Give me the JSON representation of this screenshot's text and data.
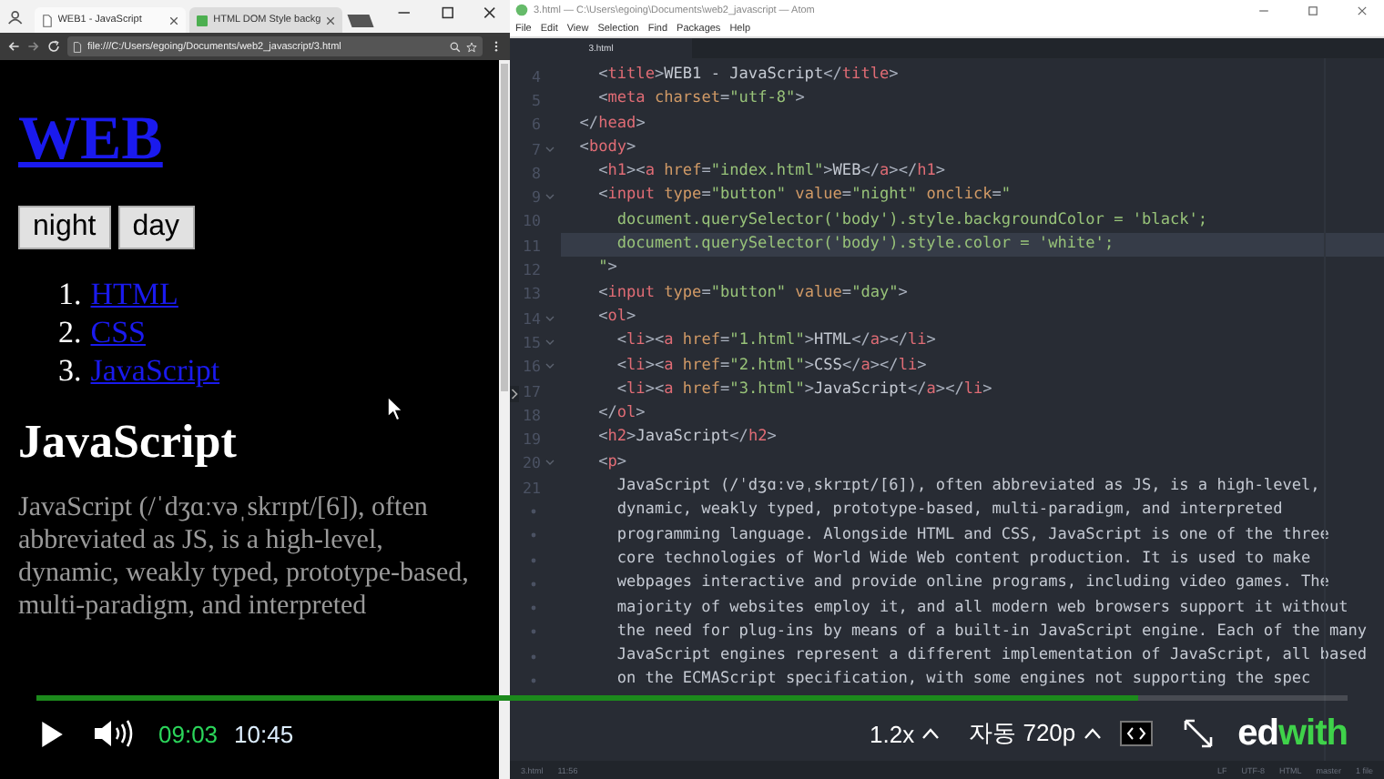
{
  "browser": {
    "tabs": [
      {
        "title": "WEB1 - JavaScript",
        "selected": true
      },
      {
        "title": "HTML DOM Style backg",
        "selected": false
      }
    ],
    "url": "file:///C:/Users/egoing/Documents/web2_javascript/3.html",
    "page": {
      "heading": "WEB",
      "buttons": [
        "night",
        "day"
      ],
      "list": [
        {
          "number": "1.",
          "label": "HTML"
        },
        {
          "number": "2.",
          "label": "CSS"
        },
        {
          "number": "3.",
          "label": "JavaScript"
        }
      ],
      "subheading": "JavaScript",
      "paragraph": "JavaScript (/ˈdʒɑːvəˌskrɪpt/[6]), often abbreviated as JS, is a high-level, dynamic, weakly typed, prototype-based, multi-paradigm, and interpreted"
    }
  },
  "editor": {
    "title": "3.html — C:\\Users\\egoing\\Documents\\web2_javascript — Atom",
    "menu": [
      "File",
      "Edit",
      "View",
      "Selection",
      "Find",
      "Packages",
      "Help"
    ],
    "tabs": [
      {
        "title": "3.html",
        "selected": true
      }
    ],
    "lines": [
      {
        "kind": "line",
        "number": "4",
        "fold": false,
        "current": false,
        "tokens": [
          {
            "kind": "punct",
            "text": "    <"
          },
          {
            "kind": "tag",
            "text": "title"
          },
          {
            "kind": "punct",
            "text": ">"
          },
          {
            "kind": "text",
            "text": "WEB1 - JavaScript"
          },
          {
            "kind": "punct",
            "text": "</"
          },
          {
            "kind": "tag",
            "text": "title"
          },
          {
            "kind": "punct",
            "text": ">"
          }
        ]
      },
      {
        "kind": "line",
        "number": "5",
        "fold": false,
        "current": false,
        "tokens": [
          {
            "kind": "punct",
            "text": "    <"
          },
          {
            "kind": "tag",
            "text": "meta"
          },
          {
            "kind": "attr",
            "text": " charset"
          },
          {
            "kind": "punct",
            "text": "="
          },
          {
            "kind": "string",
            "text": "\"utf-8\""
          },
          {
            "kind": "punct",
            "text": ">"
          }
        ]
      },
      {
        "kind": "line",
        "number": "6",
        "fold": false,
        "current": false,
        "tokens": [
          {
            "kind": "punct",
            "text": "  </"
          },
          {
            "kind": "tag",
            "text": "head"
          },
          {
            "kind": "punct",
            "text": ">"
          }
        ]
      },
      {
        "kind": "line",
        "number": "7",
        "fold": true,
        "current": false,
        "tokens": [
          {
            "kind": "punct",
            "text": "  <"
          },
          {
            "kind": "tag",
            "text": "body"
          },
          {
            "kind": "punct",
            "text": ">"
          }
        ]
      },
      {
        "kind": "line",
        "number": "8",
        "fold": false,
        "current": false,
        "tokens": [
          {
            "kind": "punct",
            "text": "    <"
          },
          {
            "kind": "tag",
            "text": "h1"
          },
          {
            "kind": "punct",
            "text": "><"
          },
          {
            "kind": "tag",
            "text": "a"
          },
          {
            "kind": "attr",
            "text": " href"
          },
          {
            "kind": "punct",
            "text": "="
          },
          {
            "kind": "string",
            "text": "\"index.html\""
          },
          {
            "kind": "punct",
            "text": ">"
          },
          {
            "kind": "text",
            "text": "WEB"
          },
          {
            "kind": "punct",
            "text": "</"
          },
          {
            "kind": "tag",
            "text": "a"
          },
          {
            "kind": "punct",
            "text": "></"
          },
          {
            "kind": "tag",
            "text": "h1"
          },
          {
            "kind": "punct",
            "text": ">"
          }
        ]
      },
      {
        "kind": "line",
        "number": "9",
        "fold": true,
        "current": false,
        "tokens": [
          {
            "kind": "punct",
            "text": "    <"
          },
          {
            "kind": "tag",
            "text": "input"
          },
          {
            "kind": "attr",
            "text": " type"
          },
          {
            "kind": "punct",
            "text": "="
          },
          {
            "kind": "string",
            "text": "\"button\""
          },
          {
            "kind": "attr",
            "text": " value"
          },
          {
            "kind": "punct",
            "text": "="
          },
          {
            "kind": "string",
            "text": "\"night\""
          },
          {
            "kind": "attr",
            "text": " onclick"
          },
          {
            "kind": "punct",
            "text": "="
          },
          {
            "kind": "string",
            "text": "\""
          }
        ]
      },
      {
        "kind": "line",
        "number": "10",
        "fold": false,
        "current": false,
        "tokens": [
          {
            "kind": "string",
            "text": "      document.querySelector('body').style.backgroundColor = 'black';"
          }
        ]
      },
      {
        "kind": "line",
        "number": "11",
        "fold": false,
        "current": true,
        "tokens": [
          {
            "kind": "string",
            "text": "      document.querySelector('body').style.color = 'white';"
          }
        ]
      },
      {
        "kind": "line",
        "number": "12",
        "fold": false,
        "current": false,
        "tokens": [
          {
            "kind": "string",
            "text": "    \""
          },
          {
            "kind": "punct",
            "text": ">"
          }
        ]
      },
      {
        "kind": "line",
        "number": "13",
        "fold": false,
        "current": false,
        "tokens": [
          {
            "kind": "punct",
            "text": "    <"
          },
          {
            "kind": "tag",
            "text": "input"
          },
          {
            "kind": "attr",
            "text": " type"
          },
          {
            "kind": "punct",
            "text": "="
          },
          {
            "kind": "string",
            "text": "\"button\""
          },
          {
            "kind": "attr",
            "text": " value"
          },
          {
            "kind": "punct",
            "text": "="
          },
          {
            "kind": "string",
            "text": "\"day\""
          },
          {
            "kind": "punct",
            "text": ">"
          }
        ]
      },
      {
        "kind": "line",
        "number": "14",
        "fold": true,
        "current": false,
        "tokens": [
          {
            "kind": "punct",
            "text": "    <"
          },
          {
            "kind": "tag",
            "text": "ol"
          },
          {
            "kind": "punct",
            "text": ">"
          }
        ]
      },
      {
        "kind": "line",
        "number": "15",
        "fold": true,
        "current": false,
        "tokens": [
          {
            "kind": "punct",
            "text": "      <"
          },
          {
            "kind": "tag",
            "text": "li"
          },
          {
            "kind": "punct",
            "text": "><"
          },
          {
            "kind": "tag",
            "text": "a"
          },
          {
            "kind": "attr",
            "text": " href"
          },
          {
            "kind": "punct",
            "text": "="
          },
          {
            "kind": "string",
            "text": "\"1.html\""
          },
          {
            "kind": "punct",
            "text": ">"
          },
          {
            "kind": "text",
            "text": "HTML"
          },
          {
            "kind": "punct",
            "text": "</"
          },
          {
            "kind": "tag",
            "text": "a"
          },
          {
            "kind": "punct",
            "text": "></"
          },
          {
            "kind": "tag",
            "text": "li"
          },
          {
            "kind": "punct",
            "text": ">"
          }
        ]
      },
      {
        "kind": "line",
        "number": "16",
        "fold": true,
        "current": false,
        "tokens": [
          {
            "kind": "punct",
            "text": "      <"
          },
          {
            "kind": "tag",
            "text": "li"
          },
          {
            "kind": "punct",
            "text": "><"
          },
          {
            "kind": "tag",
            "text": "a"
          },
          {
            "kind": "attr",
            "text": " href"
          },
          {
            "kind": "punct",
            "text": "="
          },
          {
            "kind": "string",
            "text": "\"2.html\""
          },
          {
            "kind": "punct",
            "text": ">"
          },
          {
            "kind": "text",
            "text": "CSS"
          },
          {
            "kind": "punct",
            "text": "</"
          },
          {
            "kind": "tag",
            "text": "a"
          },
          {
            "kind": "punct",
            "text": "></"
          },
          {
            "kind": "tag",
            "text": "li"
          },
          {
            "kind": "punct",
            "text": ">"
          }
        ]
      },
      {
        "kind": "line",
        "number": "17",
        "fold": false,
        "current": false,
        "tokens": [
          {
            "kind": "punct",
            "text": "      <"
          },
          {
            "kind": "tag",
            "text": "li"
          },
          {
            "kind": "punct",
            "text": "><"
          },
          {
            "kind": "tag",
            "text": "a"
          },
          {
            "kind": "attr",
            "text": " href"
          },
          {
            "kind": "punct",
            "text": "="
          },
          {
            "kind": "string",
            "text": "\"3.html\""
          },
          {
            "kind": "punct",
            "text": ">"
          },
          {
            "kind": "text",
            "text": "JavaScript"
          },
          {
            "kind": "punct",
            "text": "</"
          },
          {
            "kind": "tag",
            "text": "a"
          },
          {
            "kind": "punct",
            "text": "></"
          },
          {
            "kind": "tag",
            "text": "li"
          },
          {
            "kind": "punct",
            "text": ">"
          }
        ]
      },
      {
        "kind": "line",
        "number": "18",
        "fold": false,
        "current": false,
        "tokens": [
          {
            "kind": "punct",
            "text": "    </"
          },
          {
            "kind": "tag",
            "text": "ol"
          },
          {
            "kind": "punct",
            "text": ">"
          }
        ]
      },
      {
        "kind": "line",
        "number": "19",
        "fold": false,
        "current": false,
        "tokens": [
          {
            "kind": "punct",
            "text": "    <"
          },
          {
            "kind": "tag",
            "text": "h2"
          },
          {
            "kind": "punct",
            "text": ">"
          },
          {
            "kind": "text",
            "text": "JavaScript"
          },
          {
            "kind": "punct",
            "text": "</"
          },
          {
            "kind": "tag",
            "text": "h2"
          },
          {
            "kind": "punct",
            "text": ">"
          }
        ]
      },
      {
        "kind": "line",
        "number": "20",
        "fold": true,
        "current": false,
        "tokens": [
          {
            "kind": "punct",
            "text": "    <"
          },
          {
            "kind": "tag",
            "text": "p"
          },
          {
            "kind": "punct",
            "text": ">"
          }
        ]
      },
      {
        "kind": "line",
        "number": "21",
        "fold": false,
        "current": false,
        "tokens": [
          {
            "kind": "text",
            "text": "      JavaScript (/ˈdʒɑːvəˌskrɪpt/[6]), often abbreviated as JS, is a high-level,"
          }
        ]
      },
      {
        "kind": "wrap",
        "fold": false,
        "current": false,
        "tokens": [
          {
            "kind": "text",
            "text": "      dynamic, weakly typed, prototype-based, multi-paradigm, and interpreted"
          }
        ]
      },
      {
        "kind": "wrap",
        "fold": false,
        "current": false,
        "tokens": [
          {
            "kind": "text",
            "text": "      programming language. Alongside HTML and CSS, JavaScript is one of the three"
          }
        ]
      },
      {
        "kind": "wrap",
        "fold": false,
        "current": false,
        "tokens": [
          {
            "kind": "text",
            "text": "      core technologies of World Wide Web content production. It is used to make"
          }
        ]
      },
      {
        "kind": "wrap",
        "fold": false,
        "current": false,
        "tokens": [
          {
            "kind": "text",
            "text": "      webpages interactive and provide online programs, including video games. The"
          }
        ]
      },
      {
        "kind": "wrap",
        "fold": false,
        "current": false,
        "tokens": [
          {
            "kind": "text",
            "text": "      majority of websites employ it, and all modern web browsers support it without"
          }
        ]
      },
      {
        "kind": "wrap",
        "fold": false,
        "current": false,
        "tokens": [
          {
            "kind": "text",
            "text": "      the need for plug-ins by means of a built-in JavaScript engine. Each of the many"
          }
        ]
      },
      {
        "kind": "wrap",
        "fold": false,
        "current": false,
        "tokens": [
          {
            "kind": "text",
            "text": "      JavaScript engines represent a different implementation of JavaScript, all based"
          }
        ]
      },
      {
        "kind": "wrap",
        "fold": false,
        "current": false,
        "tokens": [
          {
            "kind": "text",
            "text": "      on the ECMAScript specification, with some engines not supporting the spec"
          }
        ]
      }
    ],
    "status_bar": {
      "left": [
        "3.html",
        "11:56"
      ],
      "right": [
        "LF",
        "UTF-8",
        "HTML",
        "master",
        "1 file"
      ]
    }
  },
  "player": {
    "level": 0.84,
    "elapsed": "09:03",
    "duration": "10:45",
    "speed": "1.2x",
    "quality": "자동 720p",
    "logo": [
      "ed",
      "with"
    ]
  }
}
